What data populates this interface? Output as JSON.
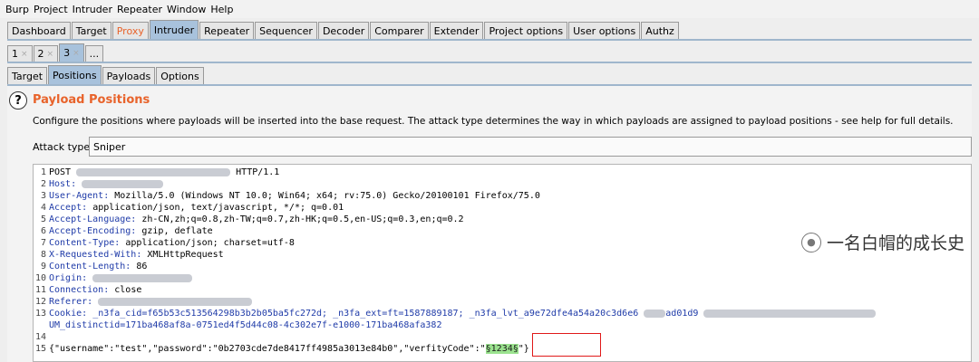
{
  "menu": [
    "Burp",
    "Project",
    "Intruder",
    "Repeater",
    "Window",
    "Help"
  ],
  "main_tabs": [
    "Dashboard",
    "Target",
    "Proxy",
    "Intruder",
    "Repeater",
    "Sequencer",
    "Decoder",
    "Comparer",
    "Extender",
    "Project options",
    "User options",
    "Authz"
  ],
  "number_tabs": [
    "1",
    "2",
    "3",
    "..."
  ],
  "sub_tabs": [
    "Target",
    "Positions",
    "Payloads",
    "Options"
  ],
  "panel": {
    "help_symbol": "?",
    "title": "Payload Positions",
    "description": "Configure the positions where payloads will be inserted into the base request. The attack type determines the way in which payloads are assigned to payload positions - see help for full details.",
    "attack_type_label": "Attack type:",
    "attack_type_value": "Sniper"
  },
  "request": {
    "l1_method": "POST",
    "l1_proto": "HTTP/1.1",
    "l2_name": "Host:",
    "l3_name": "User-Agent:",
    "l3_value": "Mozilla/5.0 (Windows NT 10.0; Win64; x64; rv:75.0) Gecko/20100101 Firefox/75.0",
    "l4_name": "Accept:",
    "l4_value": "application/json, text/javascript, */*; q=0.01",
    "l5_name": "Accept-Language:",
    "l5_value": "zh-CN,zh;q=0.8,zh-TW;q=0.7,zh-HK;q=0.5,en-US;q=0.3,en;q=0.2",
    "l6_name": "Accept-Encoding:",
    "l6_value": "gzip, deflate",
    "l7_name": "Content-Type:",
    "l7_value": "application/json; charset=utf-8",
    "l8_name": "X-Requested-With:",
    "l8_value": "XMLHttpRequest",
    "l9_name": "Content-Length:",
    "l9_value": "86",
    "l10_name": "Origin:",
    "l11_name": "Connection:",
    "l11_value": "close",
    "l12_name": "Referer:",
    "l13_name": "Cookie:",
    "l13_value": "_n3fa_cid=f65b53c513564298b3b2b05ba5fc272d; _n3fa_ext=ft=1587889187; _n3fa_lvt_a9e72dfe4a54a20c3d6e6",
    "l13_tail": "ad01d9",
    "l13_cont": "UM_distinctid=171ba468af8a-0751ed4f5d44c08-4c302e7f-e1000-171ba468afa382",
    "l15_prefix": "{\"username\":\"test\",\"password\":\"0b2703cde7de8417ff4985a3013e84b0\",\"verfityCode\":\"",
    "l15_payload": "§1234§",
    "l15_suffix": "\"}"
  },
  "watermark": "一名白帽的成长史"
}
